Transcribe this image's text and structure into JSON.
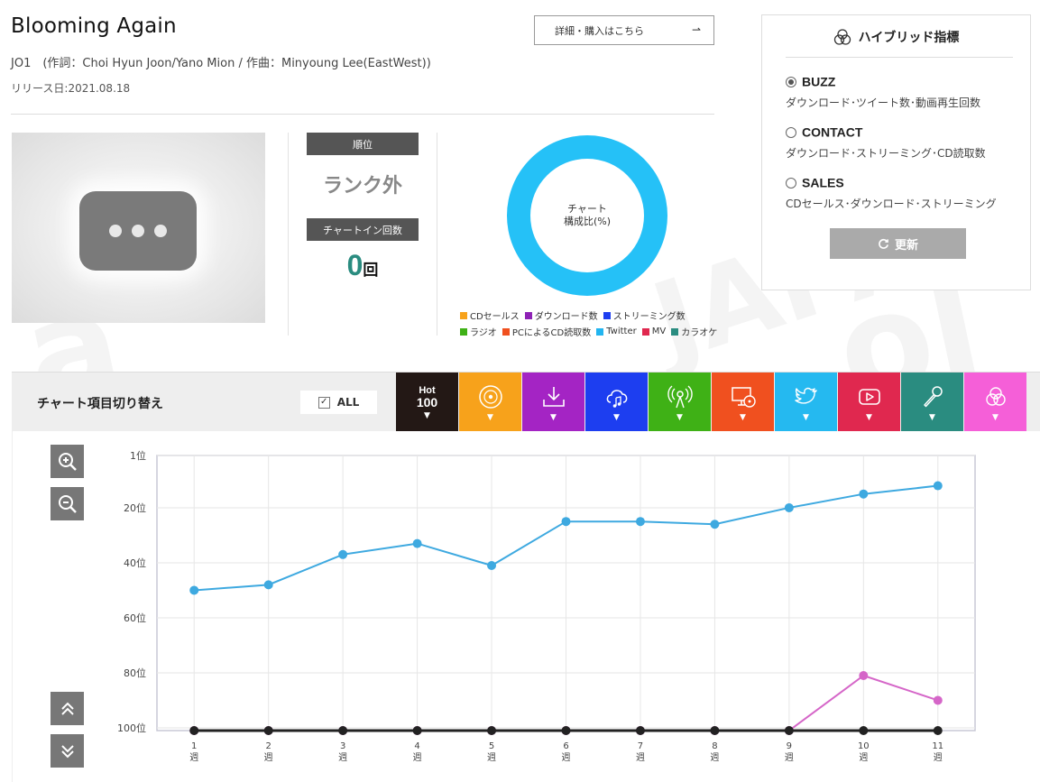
{
  "song": {
    "title": "Blooming Again",
    "credits": "JO1　(作詞：Choi Hyun Joon/Yano Mion / 作曲：Minyoung Lee(EastWest))",
    "release": "リリース日:2021.08.18",
    "detail_button": "詳細・購入はこちら",
    "detail_arrow": "⇀"
  },
  "stats": {
    "rank_label": "順位",
    "rank_value": "ランク外",
    "chartin_label": "チャートイン回数",
    "chartin_count": "0",
    "chartin_unit": "回"
  },
  "donut": {
    "center_line1": "チャート",
    "center_line2": "構成比(%)",
    "color": "#25c1f7"
  },
  "legend_row1": [
    {
      "label": "CDセールス",
      "color": "#f7a21b"
    },
    {
      "label": "ダウンロード数",
      "color": "#8e22b5"
    },
    {
      "label": "ストリーミング数",
      "color": "#1d3ef0"
    }
  ],
  "legend_row2": [
    {
      "label": "ラジオ",
      "color": "#3fb116"
    },
    {
      "label": "PCによるCD読取数",
      "color": "#f0501f"
    },
    {
      "label": "Twitter",
      "color": "#22b5f0"
    },
    {
      "label": "MV",
      "color": "#e0284f"
    },
    {
      "label": "カラオケ",
      "color": "#2a8c80"
    }
  ],
  "hybrid": {
    "title": "ハイブリッド指標",
    "options": [
      {
        "name": "BUZZ",
        "desc": "ダウンロード･ツイート数･動画再生回数",
        "selected": true
      },
      {
        "name": "CONTACT",
        "desc": "ダウンロード･ストリーミング･CD読取数",
        "selected": false
      },
      {
        "name": "SALES",
        "desc": "CDセールス･ダウンロード･ストリーミング",
        "selected": false
      }
    ],
    "refresh_label": "更新"
  },
  "switch": {
    "title": "チャート項目切り替え",
    "all_label": "ALL",
    "hot_line1": "Hot",
    "hot_line2": "100",
    "tabs": [
      {
        "icon": "hot100-icon",
        "color": "#231815"
      },
      {
        "icon": "cd-icon",
        "color": "#f7a21b"
      },
      {
        "icon": "download-icon",
        "color": "#a424c4"
      },
      {
        "icon": "streaming-icon",
        "color": "#1d3ef0"
      },
      {
        "icon": "radio-icon",
        "color": "#3fb116"
      },
      {
        "icon": "pc-cd-icon",
        "color": "#f0501f"
      },
      {
        "icon": "twitter-icon",
        "color": "#25b9f0"
      },
      {
        "icon": "mv-icon",
        "color": "#e0284f"
      },
      {
        "icon": "karaoke-icon",
        "color": "#2a8c80"
      },
      {
        "icon": "hybrid-icon",
        "color": "#f55fd8"
      }
    ]
  },
  "chart_data": {
    "type": "line",
    "y_ticks": [
      "1位",
      "20位",
      "40位",
      "60位",
      "80位",
      "100位"
    ],
    "y_tick_values": [
      1,
      20,
      40,
      60,
      80,
      100
    ],
    "ylim": [
      1,
      101
    ],
    "y_inverted": true,
    "x": [
      1,
      2,
      3,
      4,
      5,
      6,
      7,
      8,
      9,
      10,
      11
    ],
    "x_tick_top": [
      "1",
      "2",
      "3",
      "4",
      "5",
      "6",
      "7",
      "8",
      "9",
      "10",
      "11"
    ],
    "x_tick_bottom": "週",
    "grid": true,
    "series": [
      {
        "color": "#3ea9e0",
        "values": [
          50,
          48,
          37,
          33,
          41,
          25,
          25,
          26,
          20,
          15,
          12
        ]
      },
      {
        "color": "#d566c8",
        "values": [
          101,
          101,
          101,
          101,
          101,
          101,
          101,
          101,
          101,
          81,
          90
        ]
      },
      {
        "color": "#222222",
        "values": [
          101,
          101,
          101,
          101,
          101,
          101,
          101,
          101,
          101,
          101,
          101
        ]
      }
    ]
  }
}
